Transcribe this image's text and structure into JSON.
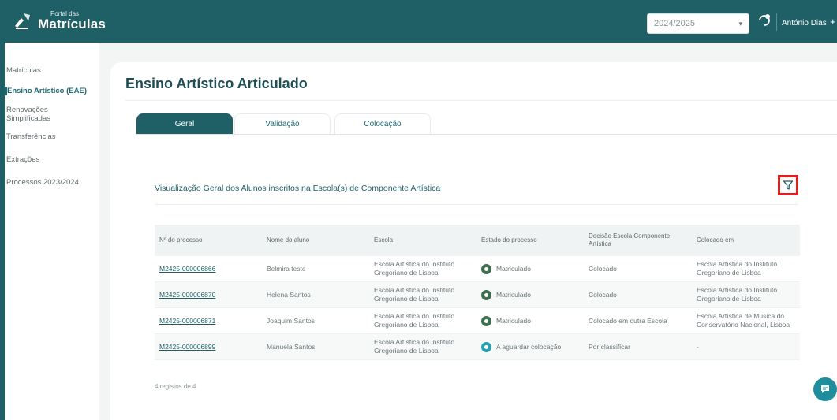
{
  "header": {
    "brand_small": "Portal das",
    "brand_big": "Matrículas",
    "year_value": "2024/2025",
    "user_name": "António Dias",
    "plus_label": "+",
    "brand_color": "#1f5f66"
  },
  "sidebar": {
    "items": [
      {
        "label": "Matrículas"
      },
      {
        "label": "Ensino Artístico (EAE)"
      },
      {
        "label": "Renovações Simplificadas"
      },
      {
        "label": "Transferências"
      },
      {
        "label": "Extrações"
      },
      {
        "label": "Processos 2023/2024"
      }
    ]
  },
  "page": {
    "title": "Ensino Artístico Articulado",
    "tabs": [
      {
        "label": "Geral"
      },
      {
        "label": "Validação"
      },
      {
        "label": "Colocação"
      }
    ],
    "section_title": "Visualização Geral dos Alunos inscritos na Escola(s) de Componente Artística",
    "records": "4 registos de 4"
  },
  "table": {
    "headers": [
      "Nº do processo",
      "Nome do aluno",
      "Escola",
      "Estado do processo",
      "Decisão Escola Componente Artística",
      "Colocado em"
    ],
    "rows": [
      {
        "process": "M2425-000006866",
        "name": "Belmira teste",
        "school": "Escola Artística do Instituto Gregoriano de Lisboa",
        "status": "Matriculado",
        "decision": "Colocado",
        "placed": "Escola Artística do Instituto Gregoriano de Lisboa"
      },
      {
        "process": "M2425-000006870",
        "name": "Helena Santos",
        "school": "Escola Artística do Instituto Gregoriano de Lisboa",
        "status": "Matriculado",
        "decision": "Colocado",
        "placed": "Escola Artística do Instituto Gregoriano de Lisboa"
      },
      {
        "process": "M2425-000006871",
        "name": "Joaquim Santos",
        "school": "Escola Artística do Instituto Gregoriano de Lisboa",
        "status": "Matriculado",
        "decision": "Colocado em outra Escola",
        "placed": "Escola Artística de Música do Conservatório Nacional, Lisboa"
      },
      {
        "process": "M2425-000006899",
        "name": "Manuela Santos",
        "school": "Escola Artística do Instituto Gregoriano de Lisboa",
        "status": "A aguardar colocação",
        "decision": "Por classificar",
        "placed": "-"
      }
    ]
  }
}
